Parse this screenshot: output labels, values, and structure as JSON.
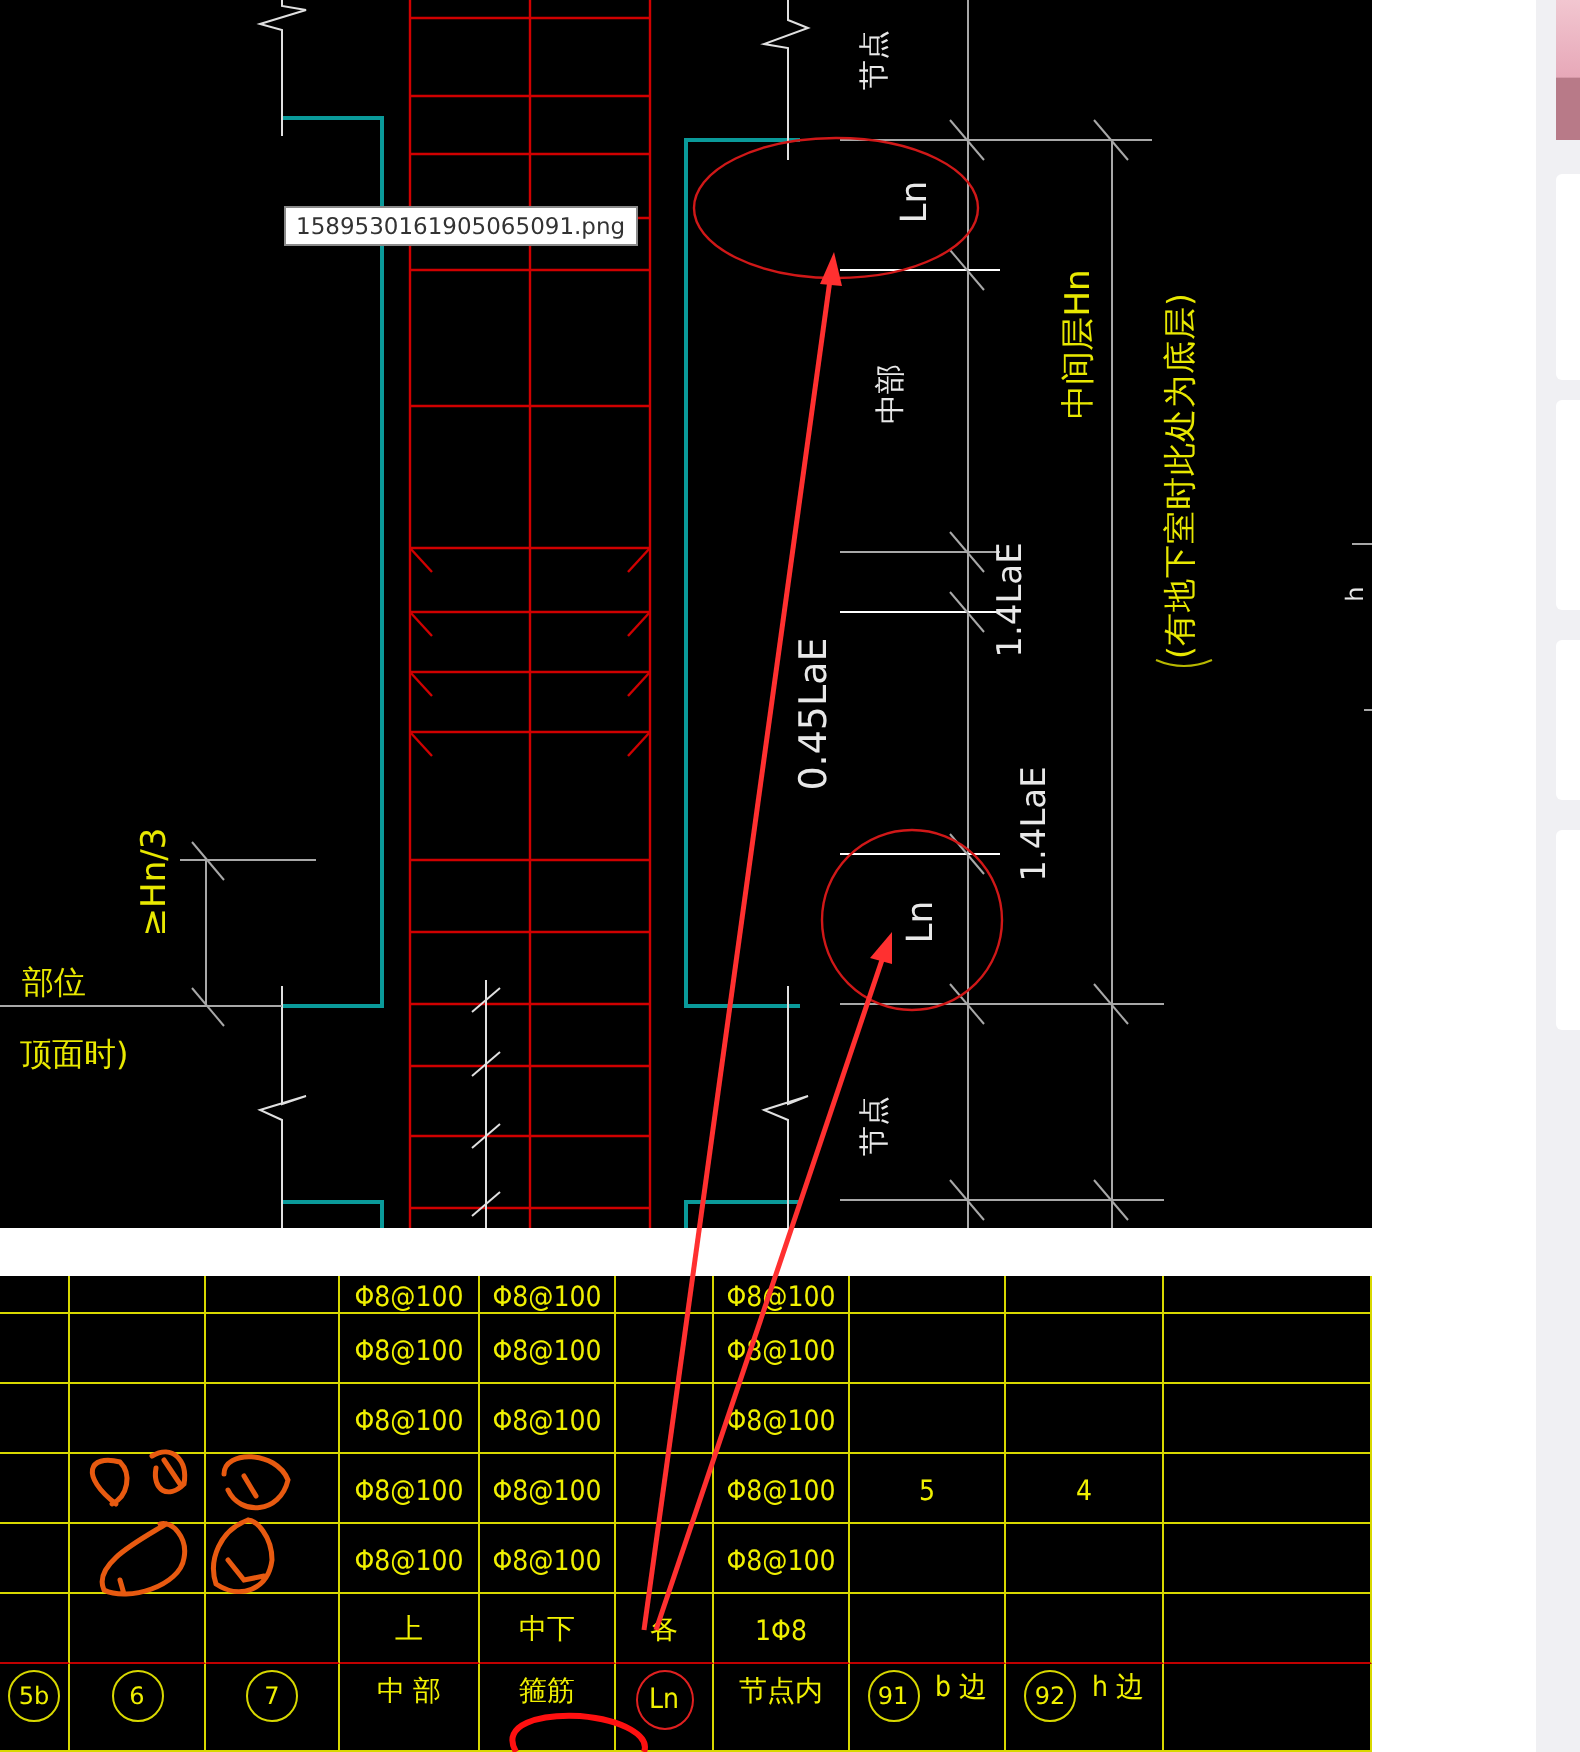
{
  "tooltip": {
    "text": "1589530161905065091.png"
  },
  "drawing": {
    "labels": [
      {
        "text": "节点",
        "kind": "dimension"
      },
      {
        "text": "Ln",
        "kind": "dimension"
      },
      {
        "text": "中部",
        "kind": "dimension"
      },
      {
        "text": "中间层Hn",
        "kind": "annotation"
      },
      {
        "text": "(有地下室时此处为底层)",
        "kind": "annotation"
      },
      {
        "text": "0.45LaE",
        "kind": "dimension"
      },
      {
        "text": "1.4LaE",
        "kind": "dimension"
      },
      {
        "text": "1.4LaE",
        "kind": "dimension"
      },
      {
        "text": "Ln",
        "kind": "dimension"
      },
      {
        "text": "节点",
        "kind": "dimension"
      },
      {
        "text": "≥Hn/3",
        "kind": "annotation"
      },
      {
        "text": "部位",
        "kind": "annotation"
      },
      {
        "text": "顶面时)",
        "kind": "annotation"
      },
      {
        "text": "h",
        "kind": "dimension"
      }
    ]
  },
  "table": {
    "rows": [
      {
        "cells": [
          {},
          {},
          {},
          {
            "text": "Φ8@100"
          },
          {
            "text": "Φ8@100"
          },
          {},
          {
            "text": "Φ8@100"
          },
          {},
          {},
          {}
        ]
      },
      {
        "cells": [
          {},
          {},
          {},
          {
            "text": "Φ8@100"
          },
          {
            "text": "Φ8@100"
          },
          {},
          {
            "text": "Φ8@100"
          },
          {},
          {},
          {}
        ]
      },
      {
        "cells": [
          {},
          {},
          {},
          {
            "text": "Φ8@100"
          },
          {
            "text": "Φ8@100"
          },
          {},
          {
            "text": "Φ8@100"
          },
          {},
          {},
          {}
        ]
      },
      {
        "cells": [
          {},
          {},
          {},
          {
            "text": "Φ8@100"
          },
          {
            "text": "Φ8@100"
          },
          {},
          {
            "text": "Φ8@100"
          },
          {
            "text": "5"
          },
          {
            "text": "4"
          },
          {}
        ]
      },
      {
        "cells": [
          {},
          {},
          {},
          {
            "text": "Φ8@100"
          },
          {
            "text": "Φ8@100"
          },
          {},
          {
            "text": "Φ8@100"
          },
          {},
          {},
          {}
        ]
      },
      {
        "cells": [
          {},
          {},
          {},
          {
            "text": "上"
          },
          {
            "text": "中下"
          },
          {
            "text": "各"
          },
          {
            "text": "1Φ8"
          },
          {},
          {},
          {}
        ]
      },
      {
        "cells": [
          {
            "marker": "5b"
          },
          {
            "marker": "6"
          },
          {
            "marker": "7"
          },
          {
            "text": "中 部"
          },
          {
            "text": "箍筋"
          },
          {
            "text": "Ln",
            "highlighted": true
          },
          {
            "text": "节点内"
          },
          {
            "marker": "91",
            "text": "b 边"
          },
          {
            "marker": "92",
            "text": "h 边"
          },
          {}
        ]
      }
    ]
  }
}
